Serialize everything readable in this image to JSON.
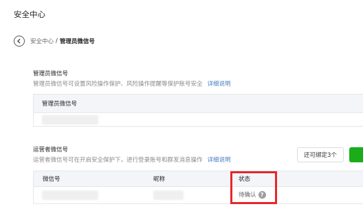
{
  "page": {
    "title": "安全中心"
  },
  "breadcrumb": {
    "parent": "安全中心",
    "separator": "/",
    "current": "管理员微信号"
  },
  "admin_section": {
    "title": "管理员微信号",
    "description": "管理员微信号可设置风险操作保护、风险操作提醒等保护账号安全",
    "link": "详细说明",
    "table_header": "管理员微信号"
  },
  "operator_section": {
    "title": "运营者微信号",
    "description": "运营者微信号可在开启安全保护下，进行登录账号和群发消息操作",
    "link": "详细说明",
    "bind_button": "还可绑定3个",
    "columns": [
      "微信号",
      "昵称",
      "状态"
    ],
    "rows": [
      {
        "status": "待确认"
      }
    ]
  },
  "icons": {
    "back": "chevron-left-circle-icon",
    "help": "question-mark-icon"
  },
  "colors": {
    "link": "#4a7fc1",
    "highlight": "#e8252a",
    "primary_green": "#1aad19"
  }
}
